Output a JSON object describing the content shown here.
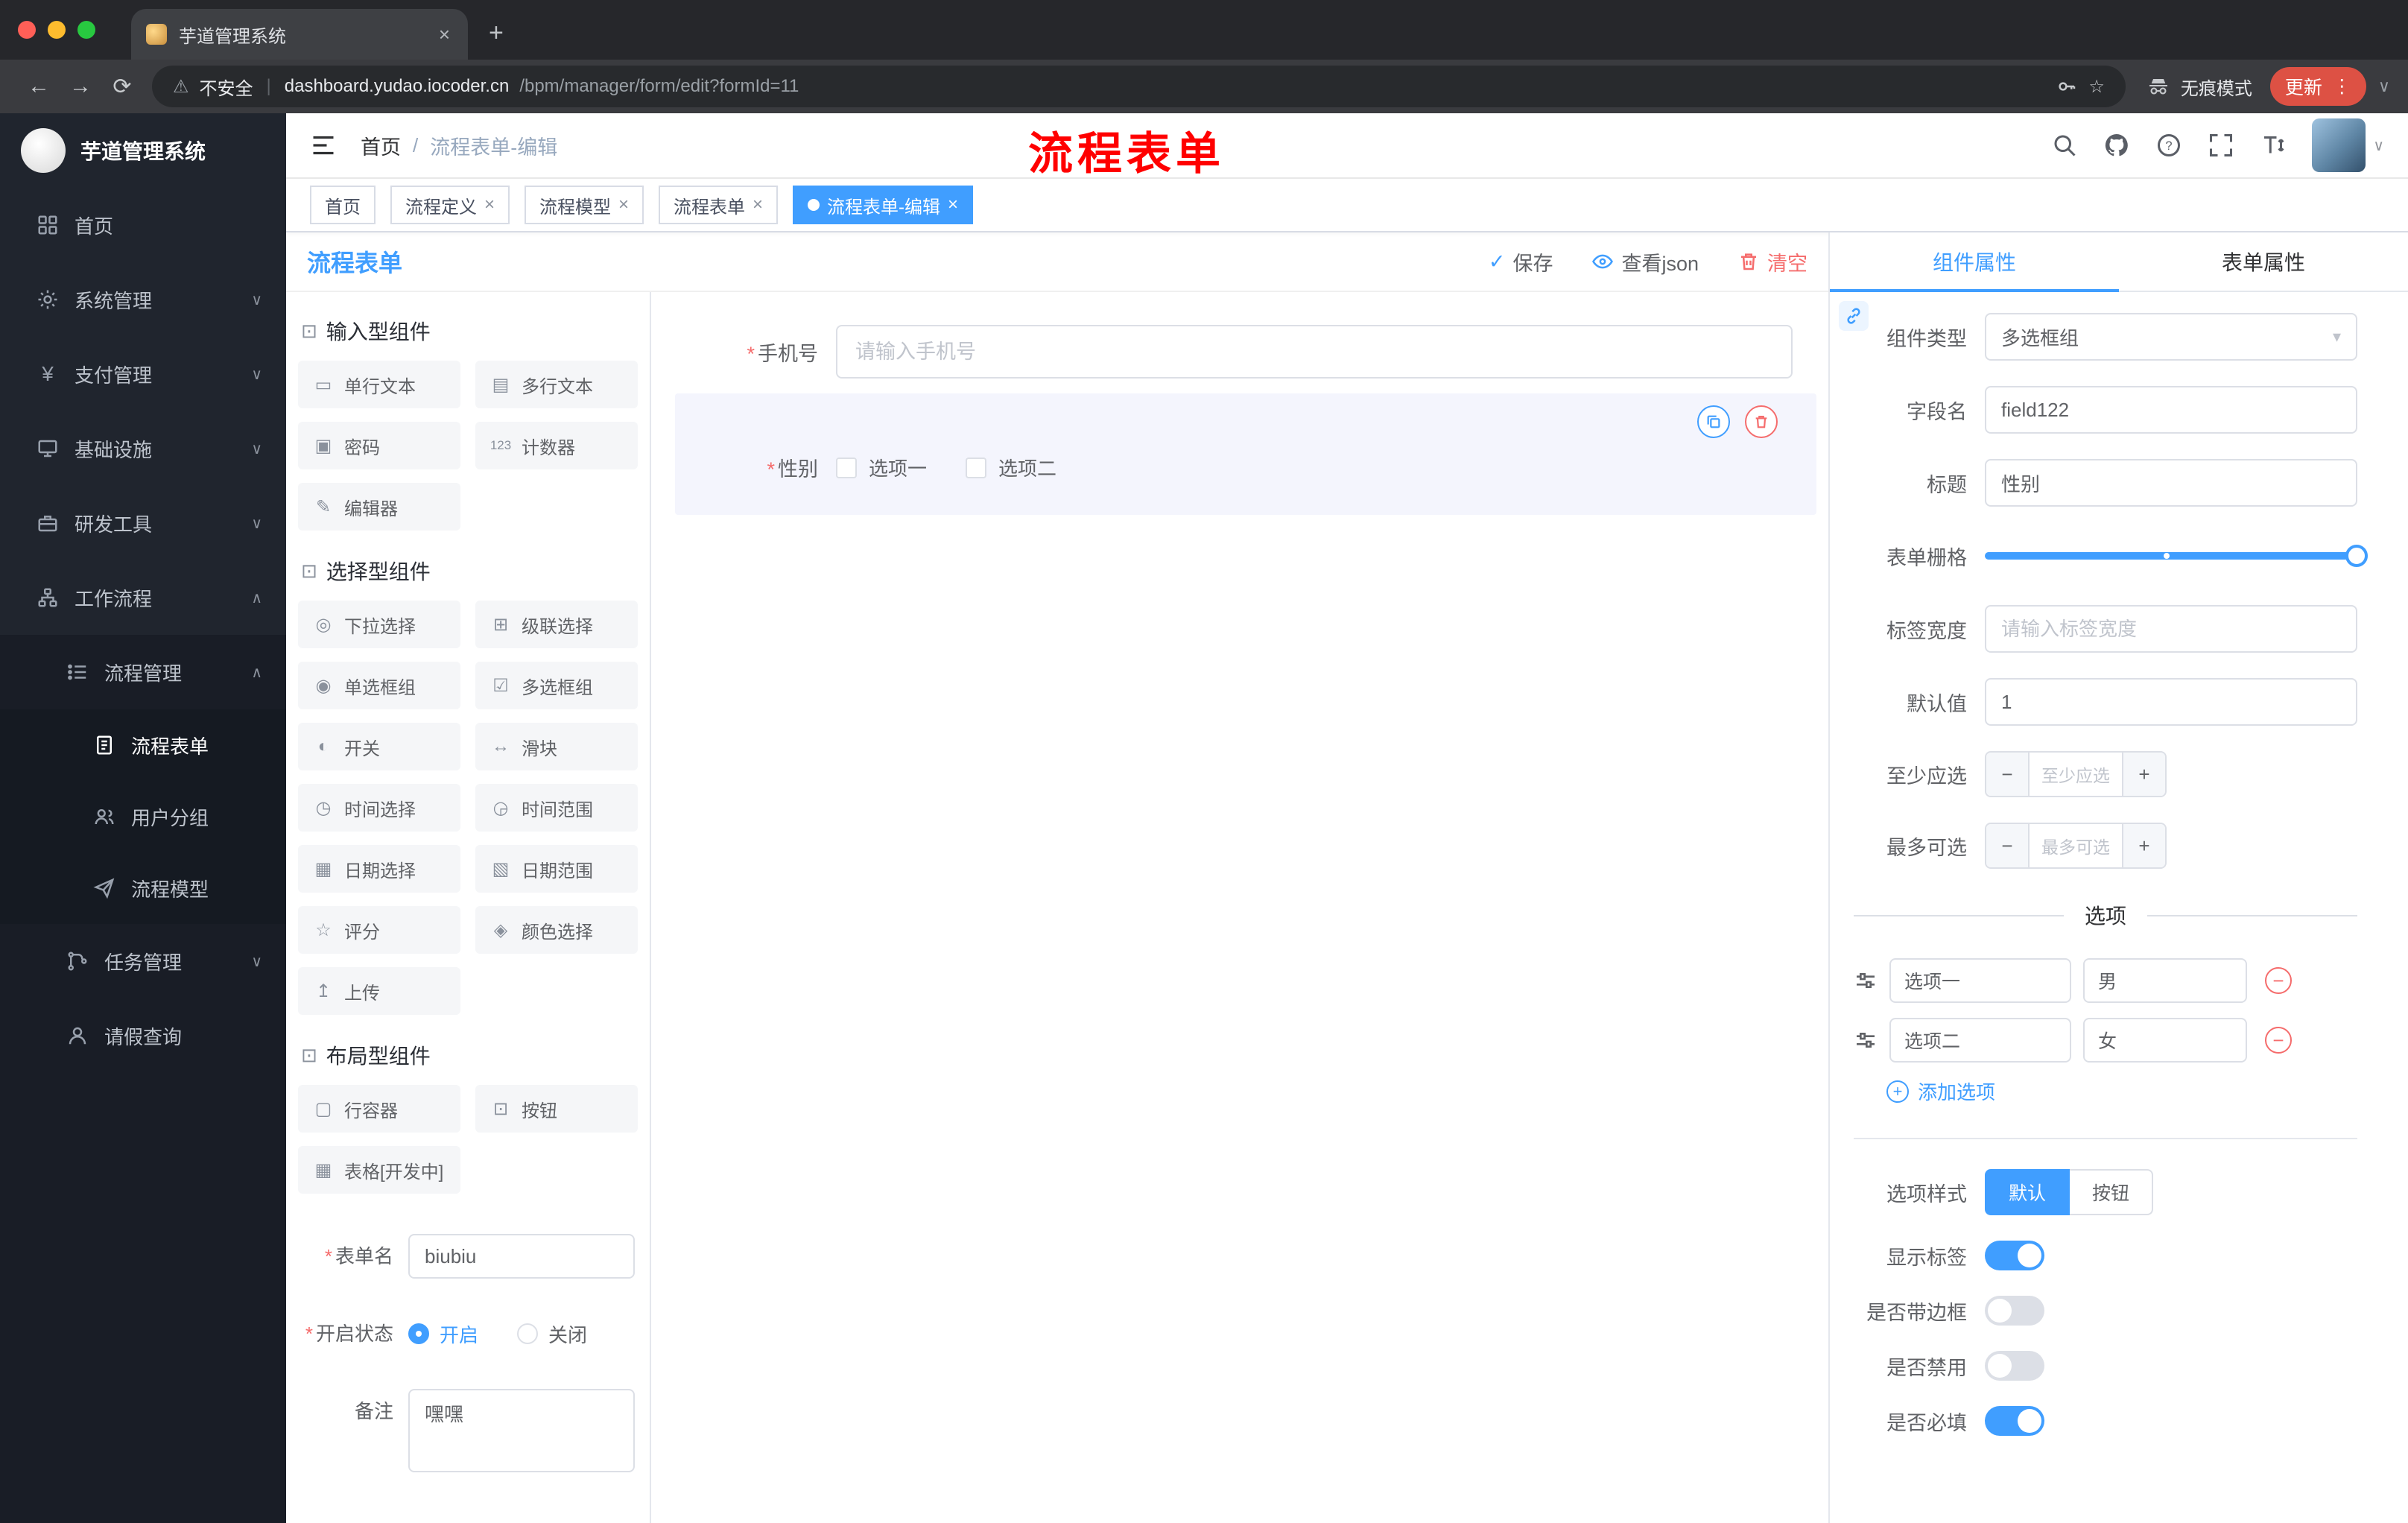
{
  "icons": {
    "close": "×",
    "plus": "+",
    "minus": "−",
    "kebab": "⋮",
    "back": "←",
    "forward": "→",
    "reload": "⟳",
    "star": "☆",
    "warning": "⚠",
    "separator": "|",
    "chevron_down": "∨",
    "chevron_up": "∧",
    "caret_down": "▾",
    "check": "✓",
    "yen": "¥",
    "question_mark": "?"
  },
  "browser": {
    "tab_title": "芋道管理系统",
    "security_label": "不安全",
    "url_domain": "dashboard.yudao.iocoder.cn",
    "url_path": "/bpm/manager/form/edit?formId=11",
    "incognito_label": "无痕模式",
    "update_label": "更新"
  },
  "sidebar": {
    "app_title": "芋道管理系统",
    "menu": [
      {
        "label": "首页"
      },
      {
        "label": "系统管理"
      },
      {
        "label": "支付管理"
      },
      {
        "label": "基础设施"
      },
      {
        "label": "研发工具"
      },
      {
        "label": "工作流程"
      }
    ],
    "process_group": {
      "label": "流程管理"
    },
    "process_children": [
      {
        "label": "流程表单"
      },
      {
        "label": "用户分组"
      },
      {
        "label": "流程模型"
      }
    ],
    "task_group": {
      "label": "任务管理"
    },
    "leave_item": {
      "label": "请假查询"
    }
  },
  "header": {
    "breadcrumb_home": "首页",
    "breadcrumb_sep": "/",
    "breadcrumb_current": "流程表单-编辑",
    "annotation": "流程表单"
  },
  "tags": [
    {
      "label": "首页"
    },
    {
      "label": "流程定义"
    },
    {
      "label": "流程模型"
    },
    {
      "label": "流程表单"
    },
    {
      "label": "流程表单-编辑"
    }
  ],
  "designer": {
    "panel_title": "流程表单",
    "save_label": "保存",
    "view_json_label": "查看json",
    "clear_label": "清空",
    "sections": [
      {
        "title": "输入型组件",
        "icon": "⊡",
        "items": [
          {
            "label": "单行文本",
            "icon": "▭"
          },
          {
            "label": "多行文本",
            "icon": "▤"
          },
          {
            "label": "密码",
            "icon": "▣"
          },
          {
            "label": "计数器",
            "icon": "123"
          },
          {
            "label": "编辑器",
            "icon": "✎"
          }
        ]
      },
      {
        "title": "选择型组件",
        "icon": "⊡",
        "items": [
          {
            "label": "下拉选择",
            "icon": "◎"
          },
          {
            "label": "级联选择",
            "icon": "⊞"
          },
          {
            "label": "单选框组",
            "icon": "◉"
          },
          {
            "label": "多选框组",
            "icon": "☑"
          },
          {
            "label": "开关",
            "icon": "◐"
          },
          {
            "label": "滑块",
            "icon": "↔"
          },
          {
            "label": "时间选择",
            "icon": "◷"
          },
          {
            "label": "时间范围",
            "icon": "◶"
          },
          {
            "label": "日期选择",
            "icon": "▦"
          },
          {
            "label": "日期范围",
            "icon": "▧"
          },
          {
            "label": "评分",
            "icon": "☆"
          },
          {
            "label": "颜色选择",
            "icon": "◈"
          },
          {
            "label": "上传",
            "icon": "↥"
          }
        ]
      },
      {
        "title": "布局型组件",
        "icon": "⊡",
        "items": [
          {
            "label": "行容器",
            "icon": "▢"
          },
          {
            "label": "按钮",
            "icon": "⊡"
          },
          {
            "label": "表格[开发中]",
            "icon": "▦"
          }
        ]
      }
    ],
    "meta": {
      "form_name_label": "表单名",
      "form_name_value": "biubiu",
      "status_label": "开启状态",
      "status_on": "开启",
      "status_off": "关闭",
      "remark_label": "备注",
      "remark_value": "嘿嘿"
    },
    "canvas": {
      "phone_label": "手机号",
      "phone_placeholder": "请输入手机号",
      "gender_label": "性别",
      "gender_option1": "选项一",
      "gender_option2": "选项二"
    }
  },
  "props": {
    "tab_component": "组件属性",
    "tab_form": "表单属性",
    "component_type_label": "组件类型",
    "component_type_value": "多选框组",
    "field_name_label": "字段名",
    "field_name_value": "field122",
    "title_label": "标题",
    "title_value": "性别",
    "grid_label": "表单栅格",
    "label_width_label": "标签宽度",
    "label_width_placeholder": "请输入标签宽度",
    "default_label": "默认值",
    "default_value": "1",
    "min_label": "至少应选",
    "min_placeholder": "至少应选",
    "max_label": "最多可选",
    "max_placeholder": "最多可选",
    "options_divider": "选项",
    "option_rows": [
      {
        "name": "选项一",
        "value": "男"
      },
      {
        "name": "选项二",
        "value": "女"
      }
    ],
    "add_option_label": "添加选项",
    "option_style_label": "选项样式",
    "style_default": "默认",
    "style_button": "按钮",
    "show_label": "显示标签",
    "border_label": "是否带边框",
    "disabled_label": "是否禁用",
    "required_label": "是否必填"
  }
}
